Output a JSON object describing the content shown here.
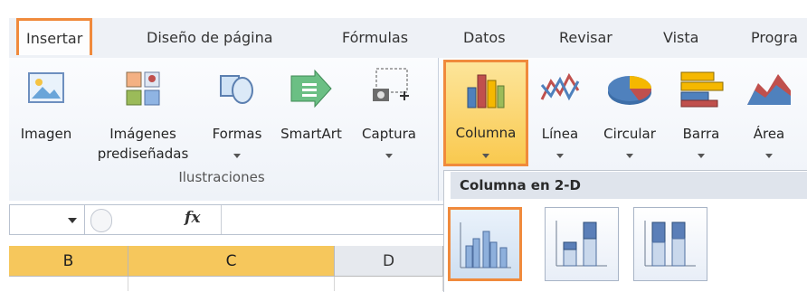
{
  "tabs": [
    "Insertar",
    "Diseño de página",
    "Fórmulas",
    "Datos",
    "Revisar",
    "Vista",
    "Progra"
  ],
  "ribbon": {
    "illustrations": {
      "group_label": "Ilustraciones",
      "commands": [
        {
          "label": "Imagen",
          "icon": "picture-icon"
        },
        {
          "label": "Imágenes prediseñadas",
          "line1": "Imágenes",
          "line2": "prediseñadas",
          "icon": "clipart-icon"
        },
        {
          "label": "Formas",
          "icon": "shapes-icon"
        },
        {
          "label": "SmartArt",
          "icon": "smartart-icon"
        },
        {
          "label": "Captura",
          "icon": "screenshot-icon"
        }
      ]
    },
    "charts": {
      "commands": [
        {
          "label": "Columna",
          "icon": "column-chart-icon"
        },
        {
          "label": "Línea",
          "icon": "line-chart-icon"
        },
        {
          "label": "Circular",
          "icon": "pie-chart-icon"
        },
        {
          "label": "Barra",
          "icon": "bar-chart-icon"
        },
        {
          "label": "Área",
          "icon": "area-chart-icon"
        }
      ]
    }
  },
  "dropdown": {
    "title": "Columna en 2-D",
    "options": [
      "clustered-column-icon",
      "stacked-column-icon",
      "100-stacked-column-icon"
    ]
  },
  "formula_bar": {
    "fx_label": "fx"
  },
  "columns": [
    "B",
    "C",
    "D"
  ],
  "colors": {
    "highlight": "#f08a3c",
    "selected_header": "#f6c75c"
  }
}
